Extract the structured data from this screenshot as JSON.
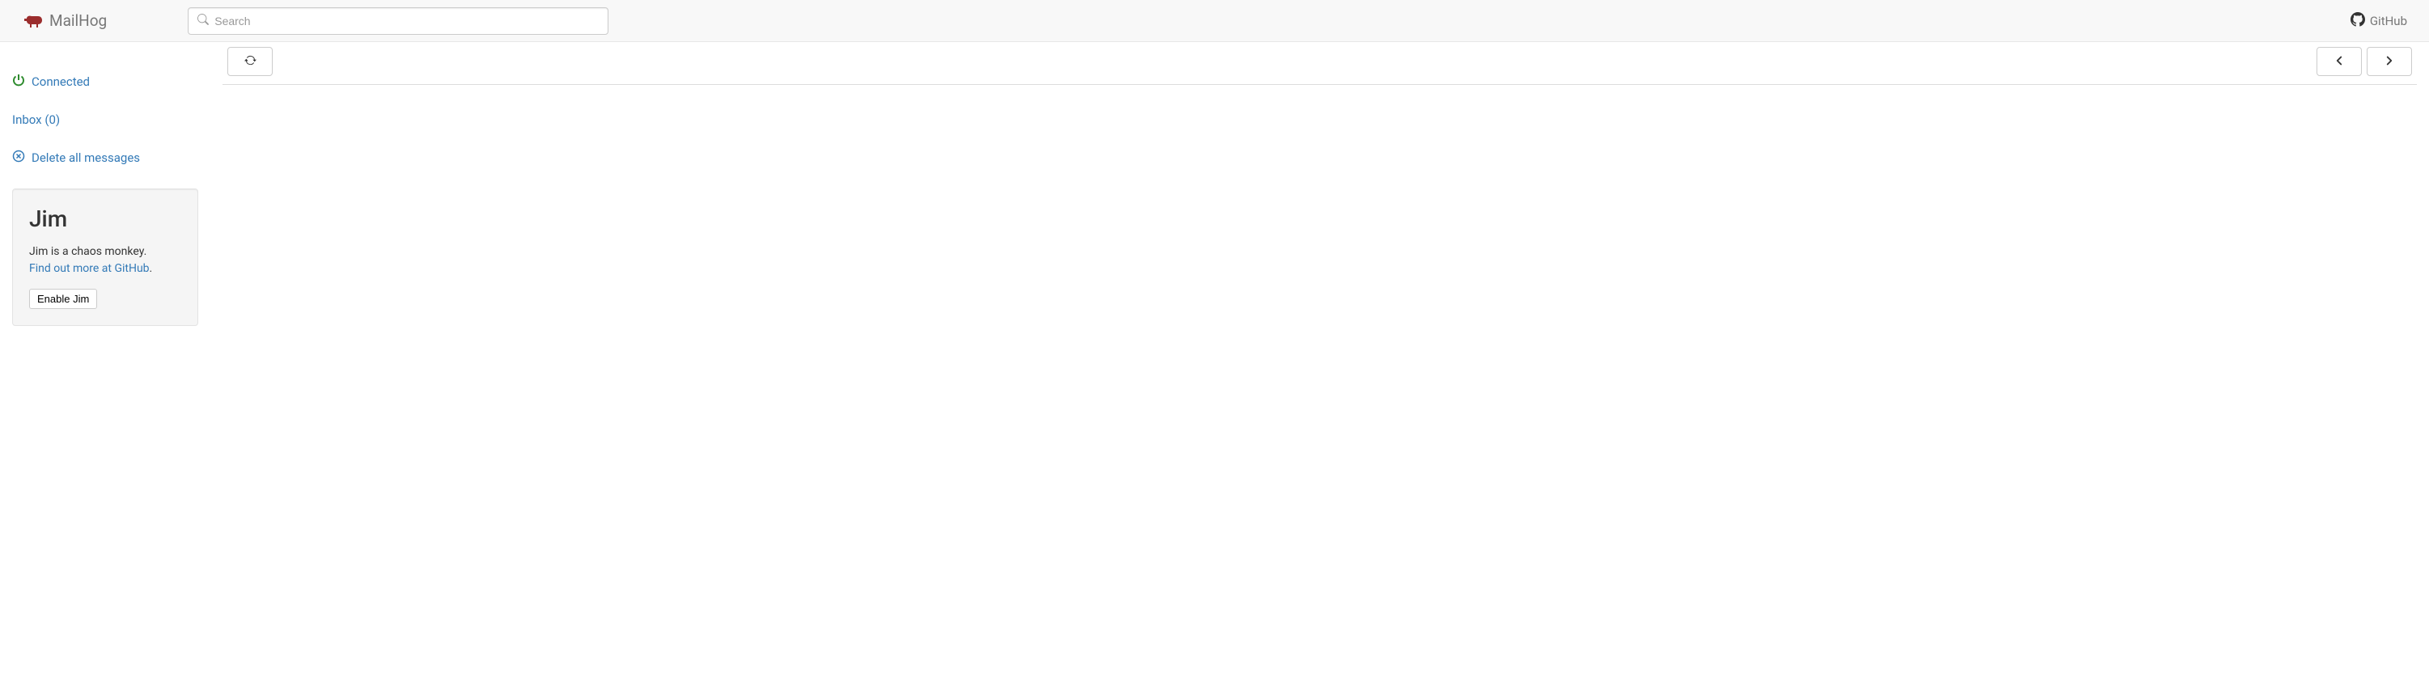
{
  "navbar": {
    "brand": "MailHog",
    "search_placeholder": "Search",
    "github_label": "GitHub"
  },
  "sidebar": {
    "connected_label": "Connected",
    "inbox_label": "Inbox (0)",
    "delete_label": "Delete all messages"
  },
  "jim": {
    "title": "Jim",
    "description": "Jim is a chaos monkey.",
    "link_text": "Find out more at GitHub",
    "link_suffix": ".",
    "enable_label": "Enable Jim"
  }
}
